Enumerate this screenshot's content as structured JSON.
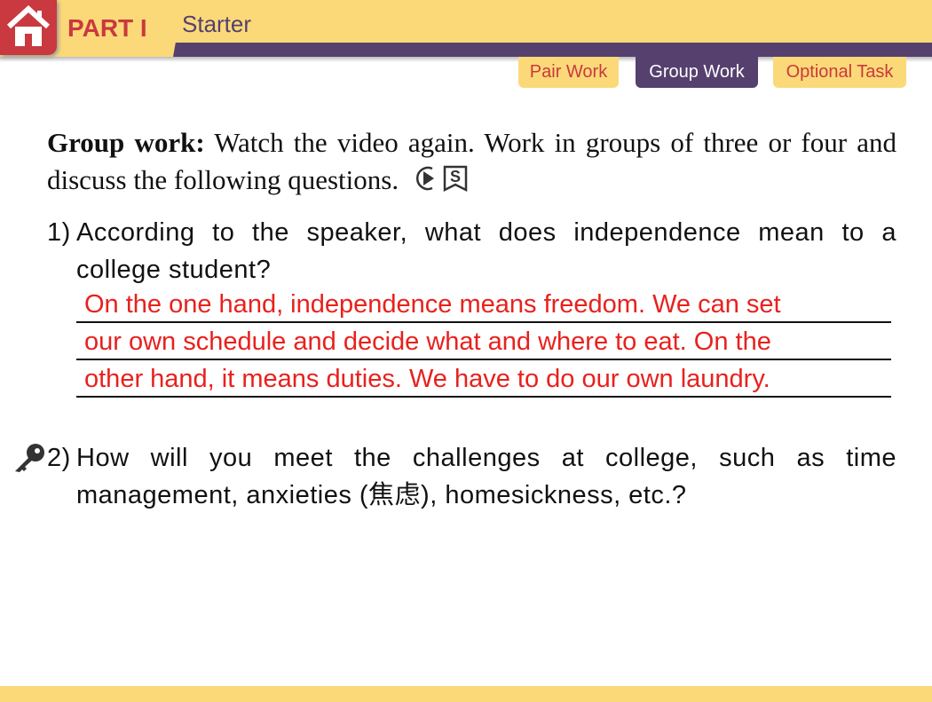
{
  "header": {
    "part": "PART I",
    "section": "Starter"
  },
  "tabs": [
    {
      "label": "Pair Work",
      "active": false
    },
    {
      "label": "Group Work",
      "active": true
    },
    {
      "label": "Optional Task",
      "active": false
    }
  ],
  "intro": {
    "bold": "Group work:",
    "text": " Watch the video again. Work in groups of three or four and discuss the following questions."
  },
  "questions": [
    {
      "num": "1)",
      "text": "According to the speaker, what does independence mean to a college student?"
    },
    {
      "num": "2)",
      "text": "How will you meet the challenges at college, such as time management, anxieties (焦虑), homesickness, etc.?"
    }
  ],
  "answer_lines": [
    "On the one hand, independence means freedom. We can set",
    "our own schedule and decide what and where to eat. On the",
    "other hand, it means duties. We have to do our own laundry."
  ],
  "colors": {
    "accent": "#c9393f",
    "purple": "#55406e",
    "yellow": "#fcd978",
    "answer": "#e8211d"
  }
}
